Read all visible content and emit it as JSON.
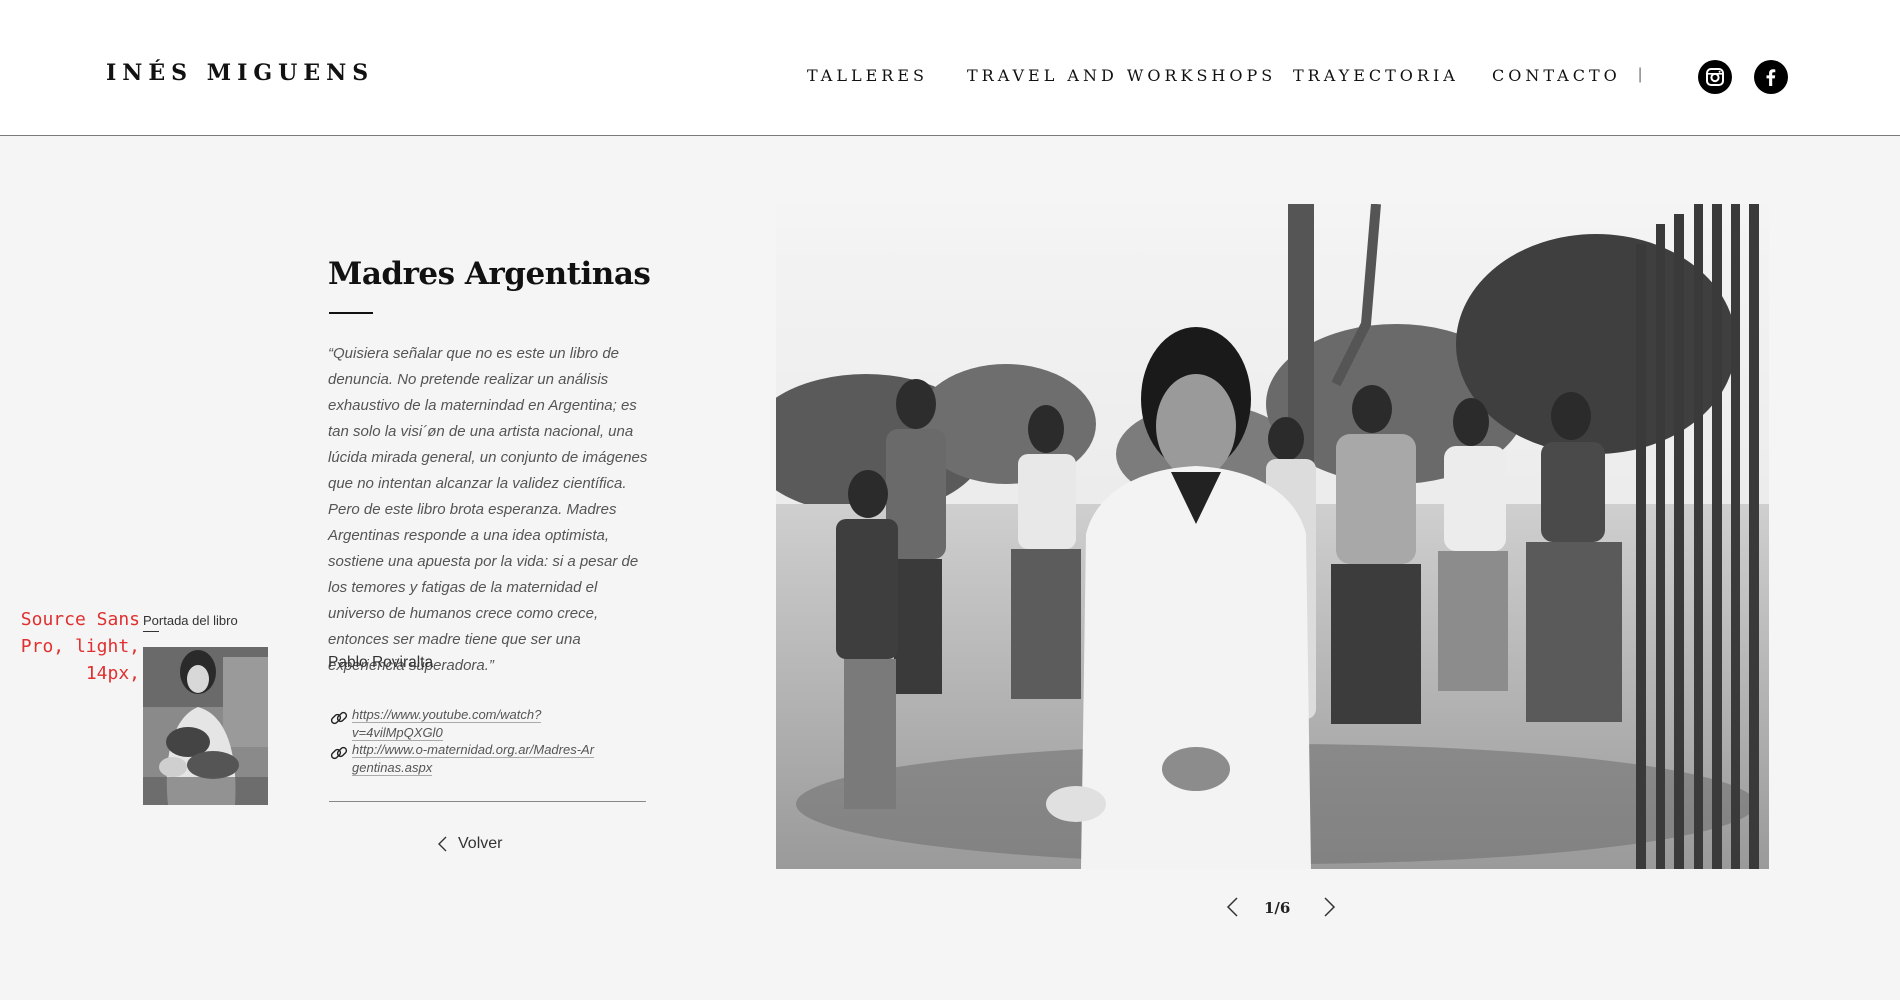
{
  "header": {
    "logo": "INÉS MIGUENS",
    "nav": [
      {
        "label": "TALLERES"
      },
      {
        "label": "TRAVEL AND WORKSHOPS"
      },
      {
        "label": "TRAYECTORIA"
      },
      {
        "label": "CONTACTO"
      }
    ],
    "separator": "|",
    "social": [
      {
        "icon": "instagram-icon"
      },
      {
        "icon": "facebook-icon"
      }
    ]
  },
  "project": {
    "title": "Madres Argentinas",
    "quote": "“Quisiera señalar que no es este un libro de denuncia. No pretende realizar un análisis exhaustivo de la maternindad en Argentina; es tan solo la visi´øn de una artista nacional, una lúcida mirada general, un conjunto de imágenes que no intentan alcanzar la validez científica. Pero de este libro brota esperanza. Madres Argentinas responde a una idea optimista, sostiene una apuesta por la vida: si a pesar de los temores y fatigas de la maternidad el universo de humanos crece como crece, entonces ser madre tiene que ser una experiencia superadora.”",
    "author": "Pablo Roviralta",
    "links": [
      {
        "text": "https://www.youtube.com/watch?v=4vilMpQXGl0",
        "icon": "link-icon"
      },
      {
        "text": "http://www.o-maternidad.org.ar/Madres-Argentinas.aspx",
        "icon": "link-icon"
      }
    ],
    "back_label": "Volver"
  },
  "annotation": "Source Sans Pro, light, 14px,",
  "cover": {
    "caption": "Portada del libro"
  },
  "gallery": {
    "counter": "1/6",
    "current": 1,
    "total": 6
  },
  "colors": {
    "page_background": "#f5f5f5",
    "header_background": "#ffffff",
    "text": "#111111",
    "annotation": "#e03030"
  }
}
